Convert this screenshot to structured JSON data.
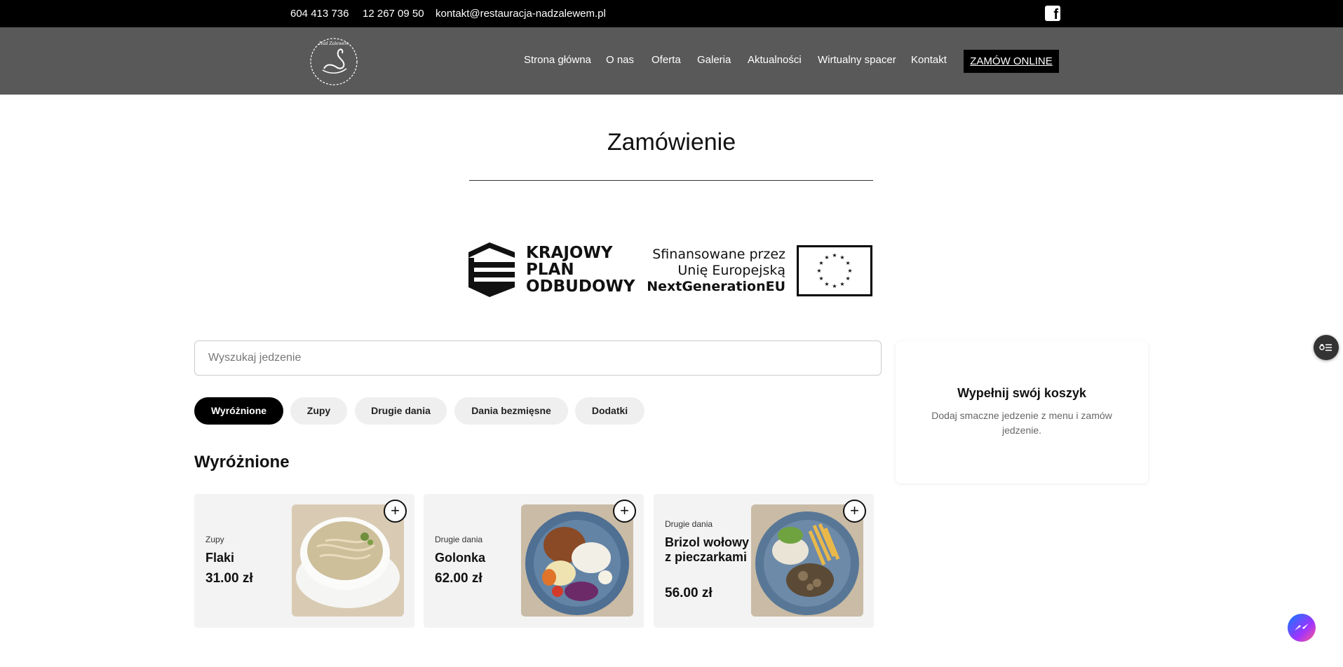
{
  "topbar": {
    "phone1": "604 413 736",
    "phone2": "12 267 09 50",
    "email": "kontakt@restauracja-nadzalewem.pl",
    "facebook_icon": "facebook-icon",
    "facebook_letter": "f"
  },
  "nav": {
    "logo_text": "Nad Zalewem",
    "items": [
      "Strona główna",
      "O nas",
      "Oferta",
      "Galeria",
      "Aktualności",
      "Wirtualny spacer",
      "Kontakt"
    ],
    "order_label": "ZAMÓW ONLINE"
  },
  "page": {
    "title": "Zamówienie"
  },
  "banner": {
    "kpo_line1": "KRAJOWY",
    "kpo_line2": "PLAN",
    "kpo_line3": "ODBUDOWY",
    "eu_line1": "Sfinansowane przez",
    "eu_line2": "Unię Europejską",
    "eu_line3": "NextGenerationEU"
  },
  "search": {
    "placeholder": "Wyszukaj jedzenie"
  },
  "categories": [
    "Wyróżnione",
    "Zupy",
    "Drugie dania",
    "Dania bezmięsne",
    "Dodatki"
  ],
  "section": {
    "title": "Wyróżnione"
  },
  "products": [
    {
      "category": "Zupy",
      "name": "Flaki",
      "price": "31.00 zł"
    },
    {
      "category": "Drugie dania",
      "name": "Golonka",
      "price": "62.00 zł"
    },
    {
      "category": "Drugie dania",
      "name": "Brizol wołowy z pieczarkami",
      "price": "56.00 zł"
    }
  ],
  "cart": {
    "title": "Wypełnij swój koszyk",
    "description": "Dodaj smaczne jedzenie z menu i zamów jedzenie."
  },
  "colors": {
    "topbar": "#000000",
    "navbar": "#595959",
    "card_bg": "#f3f3f3",
    "chip_bg": "#efefef",
    "chip_active": "#000000"
  }
}
